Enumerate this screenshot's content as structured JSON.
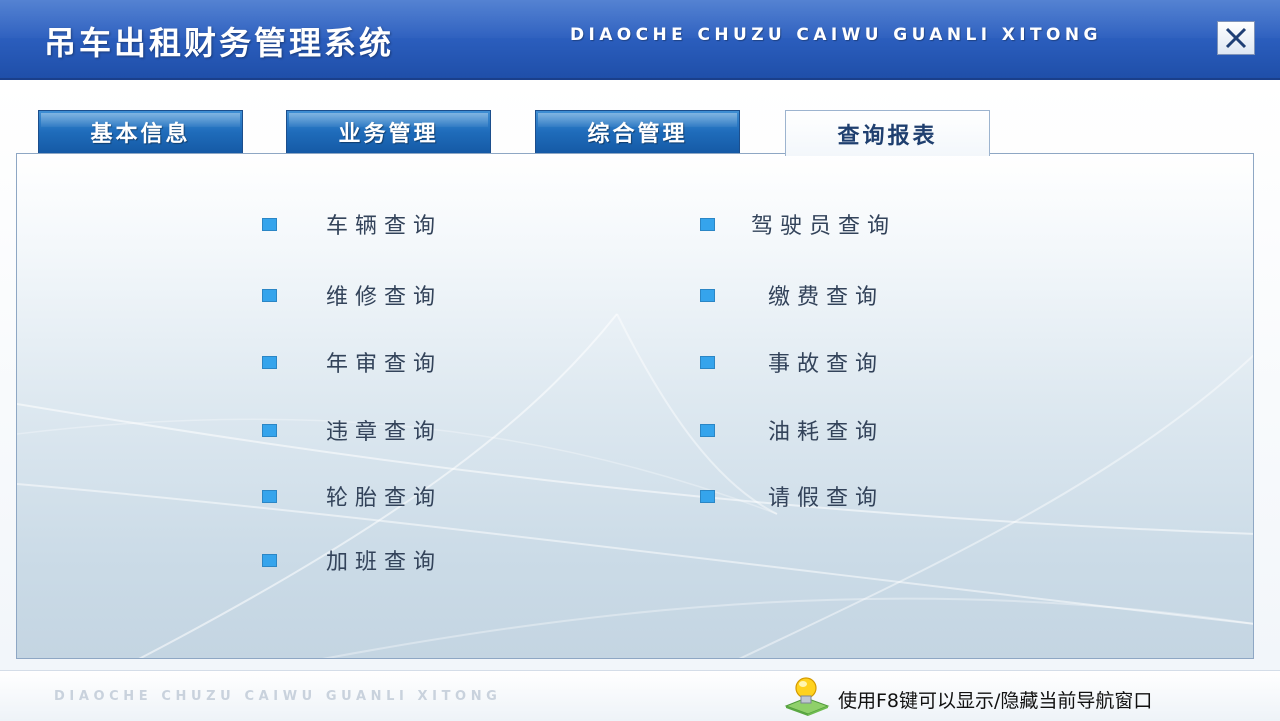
{
  "window": {
    "title": "吊车出租财务管理系统",
    "pinyin": "DIAOCHE CHUZU CAIWU GUANLI XITONG",
    "close_icon": "close-icon"
  },
  "tabs": [
    {
      "label": "基本信息",
      "active": false
    },
    {
      "label": "业务管理",
      "active": false
    },
    {
      "label": "综合管理",
      "active": false
    },
    {
      "label": "查询报表",
      "active": true
    }
  ],
  "menu": {
    "left": [
      "车辆查询",
      "维修查询",
      "年审查询",
      "违章查询",
      "轮胎查询",
      "加班查询"
    ],
    "right": [
      "驾驶员查询",
      "缴费查询",
      "事故查询",
      "油耗查询",
      "请假查询"
    ]
  },
  "footer": {
    "pinyin": "DIAOCHE CHUZU CAIWU GUANLI XITONG",
    "hint": "使用F8键可以显示/隐藏当前导航窗口",
    "hint_icon": "lightbulb-icon"
  },
  "colors": {
    "titlebar": "#2c5fbf",
    "tab_inactive": "#1f6cbb",
    "bullet": "#35a4ec",
    "menu_text": "#33435a"
  }
}
